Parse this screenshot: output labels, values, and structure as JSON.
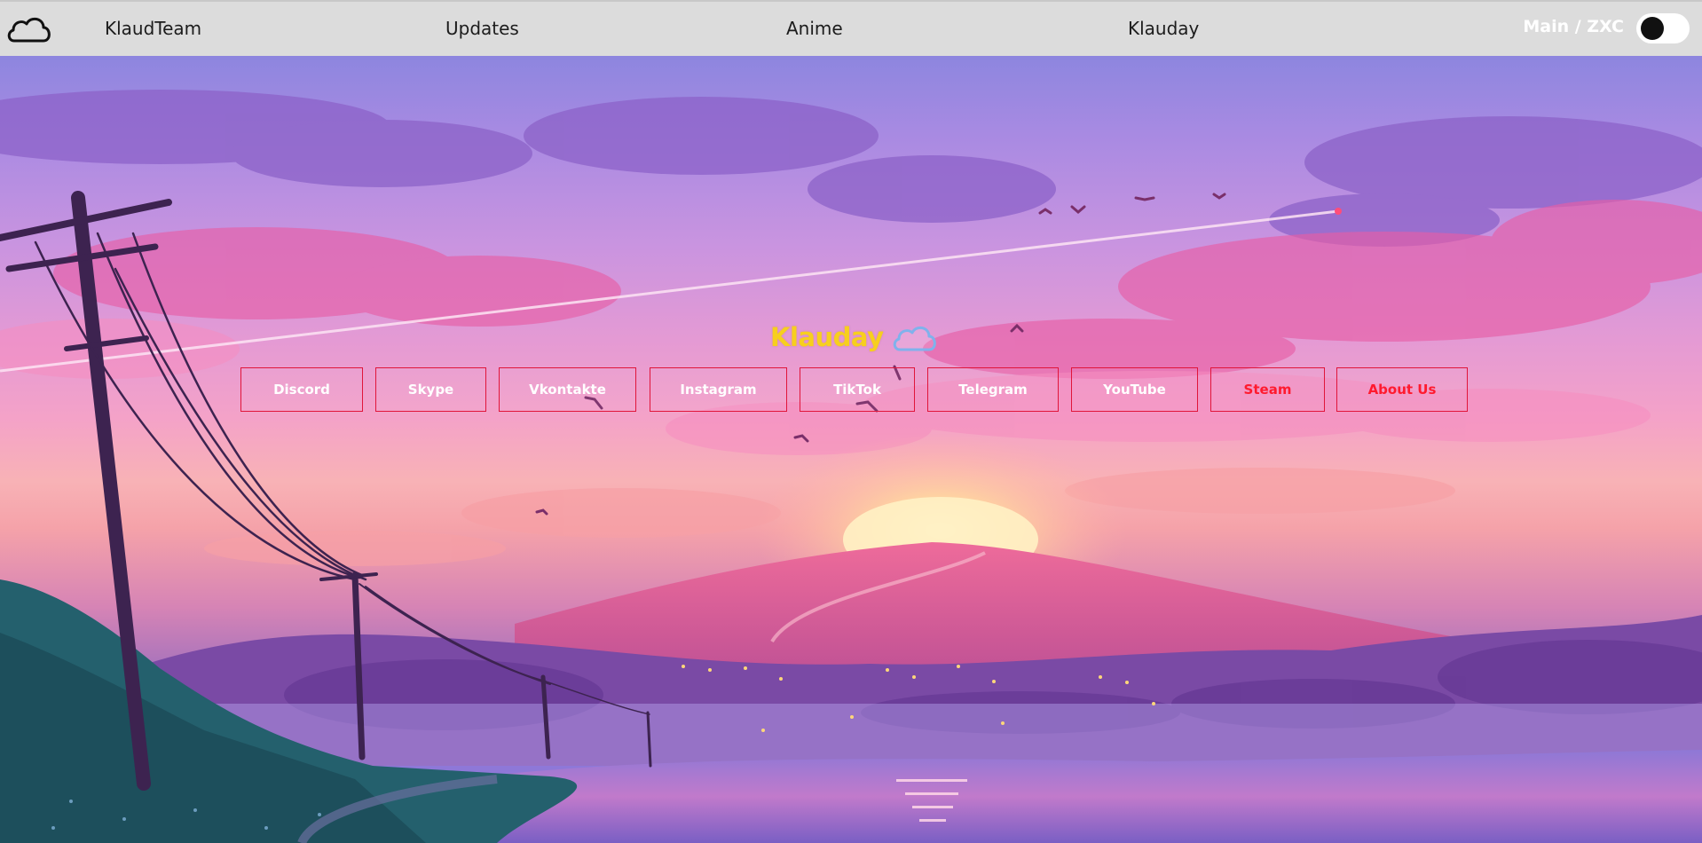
{
  "header": {
    "logo_icon": "cloud-outline-icon",
    "nav": [
      {
        "label": "KlaudTeam"
      },
      {
        "label": "Updates"
      },
      {
        "label": "Anime"
      },
      {
        "label": "Klauday"
      }
    ],
    "mode_label": "Main / ZXC",
    "toggle_state": "off"
  },
  "hero": {
    "brand": "Klauday",
    "brand_icon": "cloud-icon",
    "background": "anime sunset landscape with power lines, mountain and lake",
    "buttons": [
      {
        "label": "Discord"
      },
      {
        "label": "Skype"
      },
      {
        "label": "Vkontakte"
      },
      {
        "label": "Instagram"
      },
      {
        "label": "TikTok"
      },
      {
        "label": "Telegram"
      },
      {
        "label": "YouTube"
      },
      {
        "label": "Steam"
      },
      {
        "label": "About Us"
      }
    ]
  },
  "colors": {
    "navbar": "#dcdcdc",
    "brand": "#f7cf1e",
    "button_border": "#e0153a",
    "button_text": "#ffffff",
    "button_text_highlight": "#ff1a2e"
  }
}
